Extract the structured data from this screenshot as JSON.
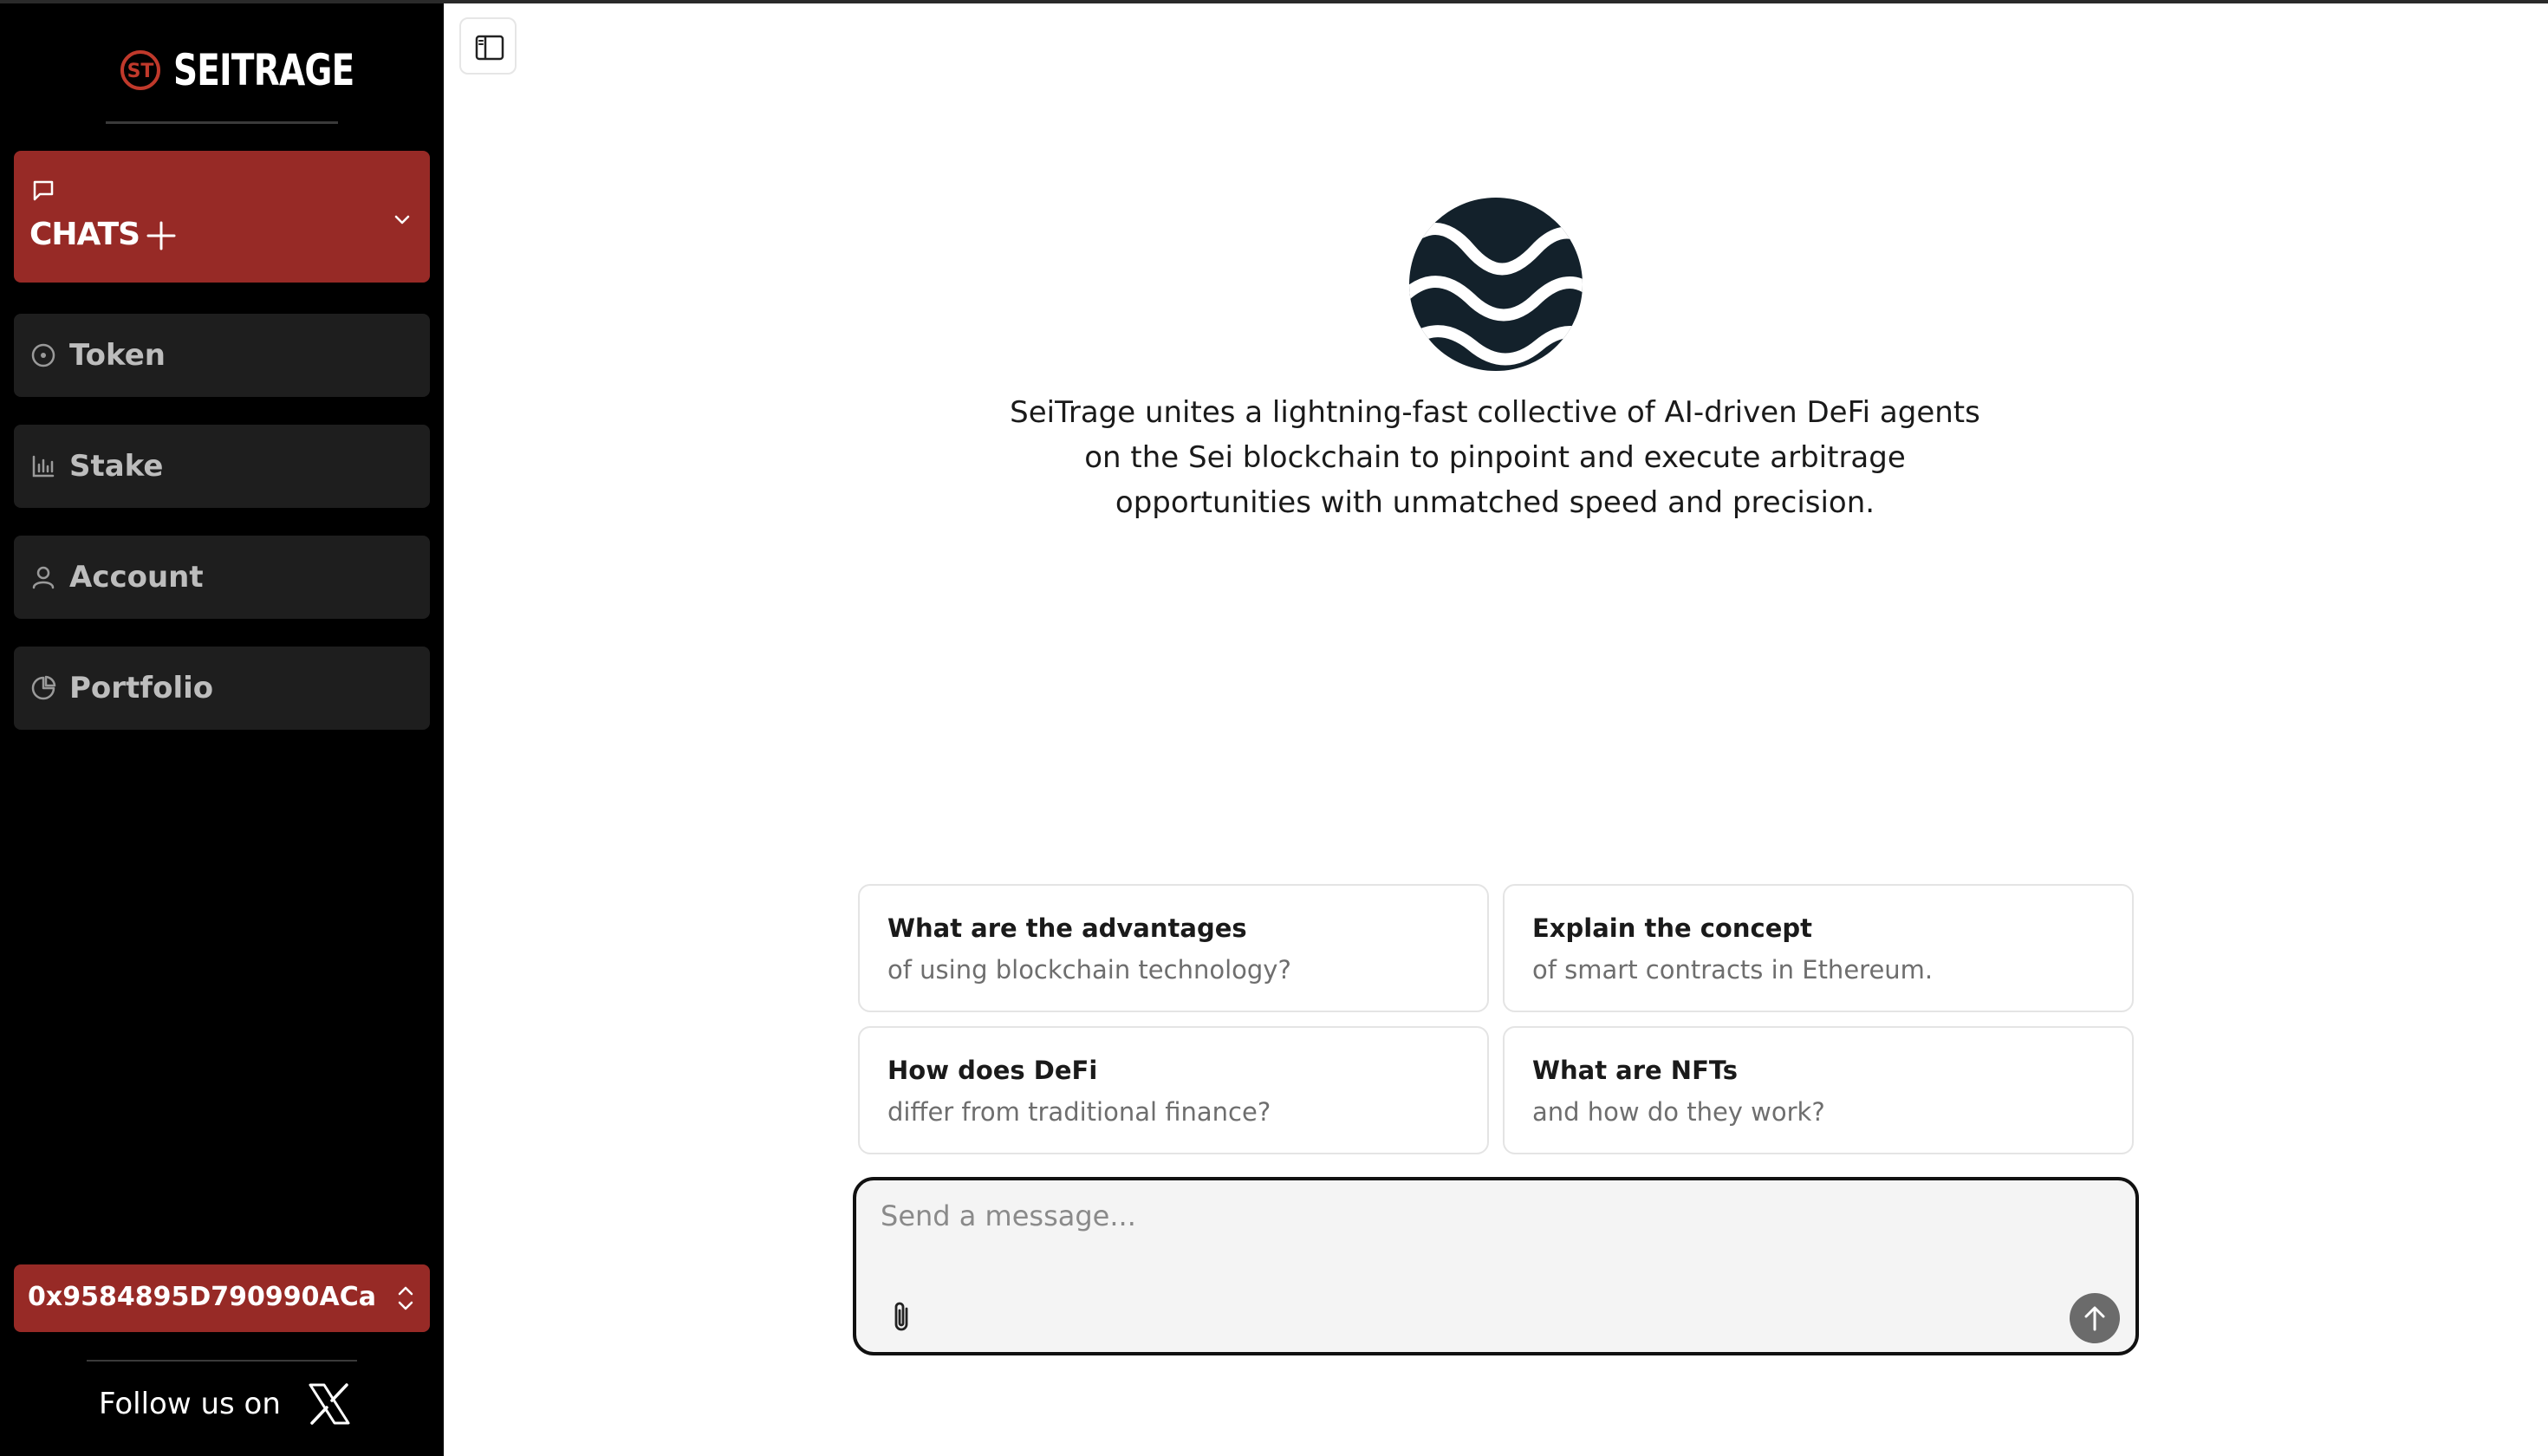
{
  "brand": {
    "name": "SEITRAGE"
  },
  "sidebar": {
    "chats_label": "CHATS",
    "items": [
      {
        "label": "Token",
        "icon": "circle-dot-icon"
      },
      {
        "label": "Stake",
        "icon": "bar-chart-icon"
      },
      {
        "label": "Account",
        "icon": "user-icon"
      },
      {
        "label": "Portfolio",
        "icon": "pie-chart-icon"
      }
    ],
    "wallet_address": "0x9584895D790990ACaC...",
    "follow_text": "Follow us on"
  },
  "main": {
    "description": "SeiTrage unites a lightning-fast collective of AI-driven DeFi agents on the Sei blockchain to pinpoint and execute arbitrage opportunities with unmatched speed and precision.",
    "description_lines": [
      "SeiTrage unites a lightning-fast collective of AI-driven DeFi agents",
      "on the Sei blockchain to pinpoint and execute arbitrage",
      "opportunities with unmatched speed and precision."
    ],
    "suggestions": [
      {
        "title": "What are the advantages",
        "subtitle": "of using blockchain technology?"
      },
      {
        "title": "Explain the concept",
        "subtitle": "of smart contracts in Ethereum."
      },
      {
        "title": "How does DeFi",
        "subtitle": "differ from traditional finance?"
      },
      {
        "title": "What are NFTs",
        "subtitle": "and how do they work?"
      }
    ],
    "composer": {
      "placeholder": "Send a message...",
      "value": ""
    }
  },
  "colors": {
    "accent": "#972a26",
    "sidebar_bg": "#000000",
    "nav_item_bg": "#1e1e1e",
    "hero_logo": "#13212b",
    "send_button": "#6b6b6b"
  }
}
